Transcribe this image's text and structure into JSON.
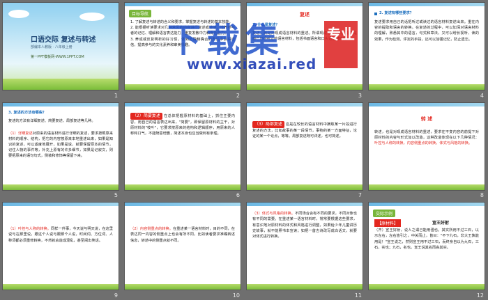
{
  "slides": [
    {
      "num": "1",
      "title": "口语交际  复述与转述",
      "subtitle": "部编本人教版 · 八年级上册",
      "site": "第一PPT模板网-WWW.1PPT.COM"
    },
    {
      "num": "2",
      "badge": "目标导航",
      "text": "1. 了解复述与转述的含义和要求，掌握复述与转述的基本技能。\n2. 能根据听读要求对几种常见的内容进行复述或转述，培养参与者的记忆、理解和语言表达能力，重复发散中力和概括能力。\n3. 养成或反复明析的好习惯，做到正确精确合的表达中获得自信，提高参与的文化素养和审美情趣。"
    },
    {
      "num": "3",
      "head": "复述",
      "q": "1. 什么是复述？",
      "text": "复述，就是对现成语言材料的重述。所谓现成语言材料，指的是面已已经听过的语言材料，包括书面语言和口头语言材料的..."
    },
    {
      "num": "4",
      "head": "2. 复述有哪些要求？",
      "text": "复述要求用自己的话把听过或读过的语言材料复述出来。重在内容的提取和语言的转换。在复述的过程中，可以加深对语言材料的理解，熟悉其中的语言，句式和章法，又可以增长视听、读的效果，作为检测、评定的手段，还可以加强记忆，防止遗忘。"
    },
    {
      "num": "5",
      "head": "3. 复述的方法有哪些？",
      "text1": "复述的方法有详细复述、简要复述、局部复述等几种。",
      "label": "（1）详细复述",
      "text2": "对原来的语言材料进行详细的复述，要求按照原来材料的顺序、结构，把它的内容按原来本地重述出来，如果是知识的复述，可以适度地展开，如果是说，就要保留原本的情节，记住人物的事件等，补充上原有的许多细节，如果是记叙文，则要把原来的语句句式，侧装和修饰等保留下来。"
    },
    {
      "num": "6",
      "label": "（2）简要复述",
      "text": "在总体把握原材料的基础上，抓住主要内容，用自己的语言表达出来，\"简要\"，即保留原材料的主干，对原材料的\"枝叶\"，它要求按原来的结构和逻辑顺序，用原来的人称和口气，不能随意增删，简述本身也应当做到有条理。"
    },
    {
      "num": "7",
      "label": "（3）局部复述",
      "text": "这是在较长的语言材料中摘取某一片段进行复述的方法，比如故事的某一段情节，事物的某一方面特征，论证的某一个论点，等等。局部复述既可详述，也可简述。"
    },
    {
      "num": "8",
      "head": "转 述",
      "text": "转述，也是对现成语言材料的重述，要求在不变内容的前提下对原材料的内容与形式加以改造，这种改造体现在以下几种情况：",
      "highlight": "叶控与人称的转换，内容侧重点的转换，体式与风格的转换。"
    },
    {
      "num": "9",
      "label": "（1）叶控与人称的转换。",
      "text": "同样一件事，今天说与明天说，在这里说与在那里说，跟这个人说与跟那个人说，时间词、方位词、人称词都必须重修转换，不然就会造成混乱，甚至闹出笑话。"
    },
    {
      "num": "10",
      "label": "（2）内容侧重点的转换。",
      "text": "在重述某一语言材料时，目的不同，在表达同一内容的侧重点上也会有所不同，比如读者要求准确转述信息，转述中的侧重点就不同。"
    },
    {
      "num": "11",
      "label": "（3）体式与风格的转换。",
      "text": "不同场合会有不同的要求，不同对象也有不同的需要。在重述某一语言材料时，常常要根据这些要求，有意识地对原材料的体式和风格进行调整，如果给少年儿童讲历史故事，就不能照书本宣读；如把一首古诗改写成白话文，就要对体式进行转换。"
    },
    {
      "num": "12",
      "badge": "交际示例",
      "label": "【原材料】",
      "poem_title": "宣王好射",
      "text": "（齐）宣王好射，说人之谓己能用强也。其实所用不过三石，以示左右，左右皆引之，中关而止，皆曰：\"不下九石，非大王孰能用是！\"宣王说之，然则宣王用不过三石，而终身自以为九石，三石，实也；九石，名也。宣王说其名而丧其实。"
    }
  ],
  "watermark": {
    "big": "下载集",
    "box": "专业",
    "url": "www.xiazai.red"
  }
}
